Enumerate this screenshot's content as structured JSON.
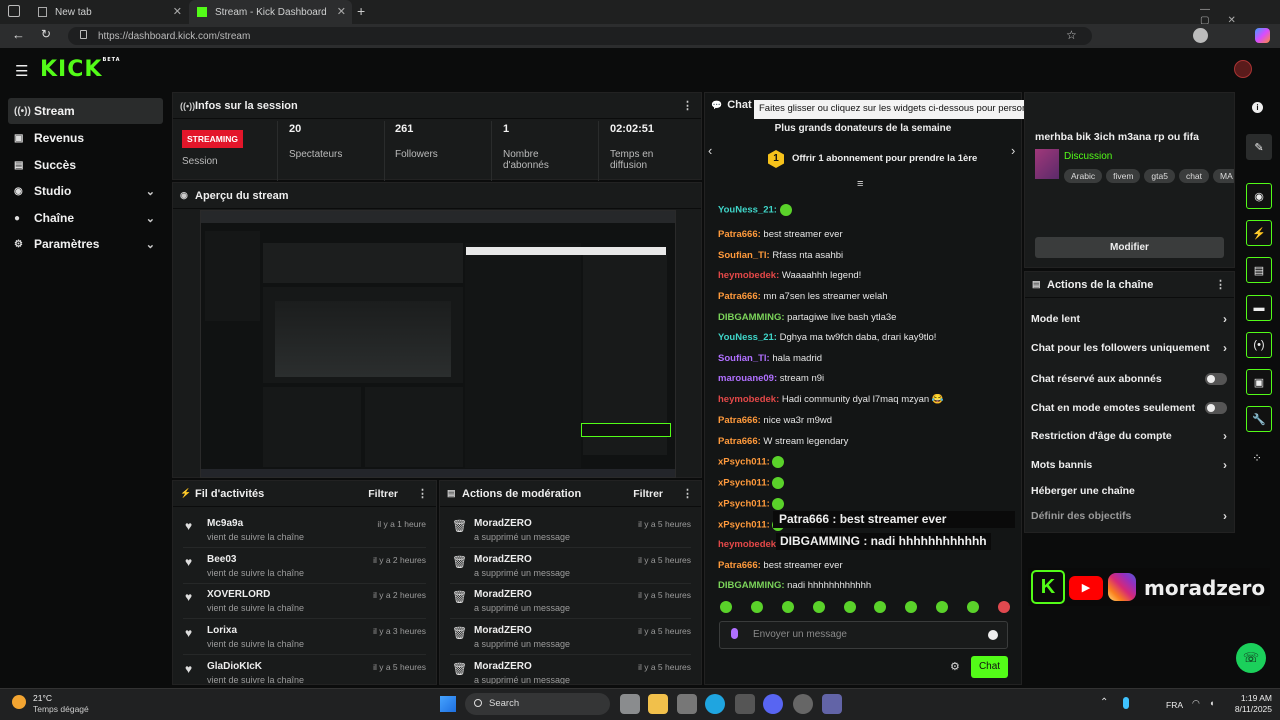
{
  "browser": {
    "tabs": [
      {
        "label": "New tab"
      },
      {
        "label": "Stream - Kick Dashboard"
      }
    ],
    "url": "https://dashboard.kick.com/stream"
  },
  "logo": {
    "text": "KICK",
    "badge": "BETA"
  },
  "sidebar": {
    "items": [
      {
        "label": "Stream"
      },
      {
        "label": "Revenus"
      },
      {
        "label": "Succès"
      },
      {
        "label": "Studio"
      },
      {
        "label": "Chaîne"
      },
      {
        "label": "Paramètres"
      }
    ]
  },
  "session": {
    "title": "Infos sur la session",
    "status": "STREAMING",
    "status_label": "Session",
    "stats": [
      {
        "value": "20",
        "label": "Spectateurs"
      },
      {
        "value": "261",
        "label": "Followers"
      },
      {
        "value": "1",
        "label": "Nombre d'abonnés"
      },
      {
        "value": "02:02:51",
        "label": "Temps en diffusion"
      }
    ]
  },
  "preview": {
    "title": "Aperçu du stream"
  },
  "activity": {
    "title": "Fil d'activités",
    "filter": "Filtrer",
    "rows": [
      {
        "name": "Mc9a9a",
        "sub": "vient de suivre la chaîne",
        "time": "il y a 1 heure"
      },
      {
        "name": "Bee03",
        "sub": "vient de suivre la chaîne",
        "time": "il y a 2 heures"
      },
      {
        "name": "XOVERLORD",
        "sub": "vient de suivre la chaîne",
        "time": "il y a 2 heures"
      },
      {
        "name": "Lorixa",
        "sub": "vient de suivre la chaîne",
        "time": "il y a 3 heures"
      },
      {
        "name": "GlaDioKIcK",
        "sub": "vient de suivre la chaîne",
        "time": "il y a 5 heures"
      }
    ]
  },
  "moderation": {
    "title": "Actions de modération",
    "filter": "Filtrer",
    "rows": [
      {
        "name": "MoradZERO",
        "sub": "a supprimé un message",
        "time": "il y a 5 heures"
      },
      {
        "name": "MoradZERO",
        "sub": "a supprimé un message",
        "time": "il y a 5 heures"
      },
      {
        "name": "MoradZERO",
        "sub": "a supprimé un message",
        "time": "il y a 5 heures"
      },
      {
        "name": "MoradZERO",
        "sub": "a supprimé un message",
        "time": "il y a 5 heures"
      },
      {
        "name": "MoradZERO",
        "sub": "a supprimé un message",
        "time": "il y a 5 heures"
      }
    ]
  },
  "chat": {
    "title": "Chat",
    "tooltip": "Faites glisser ou cliquez sur les widgets ci-dessous pour personnaliser l'affichage de votre tableau de bord",
    "donors_title": "Plus grands donateurs de la semaine",
    "donors_rank": "1",
    "donors_text": "Offrir 1 abonnement pour prendre la 1ère",
    "input_placeholder": "Envoyer un message",
    "send": "Chat",
    "messages": [
      {
        "user": "YouNess_21:",
        "text": "",
        "color": "#3fd5c8",
        "emote": true
      },
      {
        "user": "Patra666:",
        "text": "best streamer ever",
        "color": "#ff9a3c"
      },
      {
        "user": "Soufian_Tl:",
        "text": "Rfass nta asahbi",
        "color": "#ff9a3c"
      },
      {
        "user": "heymobedek:",
        "text": "Waaaahhh legend!",
        "color": "#e34848"
      },
      {
        "user": "Patra666:",
        "text": "mn a7sen les streamer welah",
        "color": "#ff9a3c"
      },
      {
        "user": "DIBGAMMING:",
        "text": "partagiwe live bash ytla3e",
        "color": "#7bd45a"
      },
      {
        "user": "YouNess_21:",
        "text": "Dghya ma tw9fch daba, drari kay9tlo!",
        "color": "#3fd5c8"
      },
      {
        "user": "Soufian_Tl:",
        "text": "hala madrid",
        "color": "#b070ff"
      },
      {
        "user": "marouane09:",
        "text": "stream n9i",
        "color": "#b070ff"
      },
      {
        "user": "heymobedek:",
        "text": "Hadi community dyal l7maq mzyan 😂",
        "color": "#e34848"
      },
      {
        "user": "Patra666:",
        "text": "nice wa3r m9wd",
        "color": "#ff9a3c"
      },
      {
        "user": "Patra666:",
        "text": "W stream legendary",
        "color": "#ff9a3c"
      },
      {
        "user": "xPsych011:",
        "text": "",
        "color": "#ff9a3c",
        "emote": true
      },
      {
        "user": "xPsych011:",
        "text": "",
        "color": "#ff9a3c",
        "emote": true
      },
      {
        "user": "xPsych011:",
        "text": "",
        "color": "#ff9a3c",
        "emote": true
      },
      {
        "user": "xPsych011:",
        "text": "",
        "color": "#ff9a3c",
        "emote": true
      },
      {
        "user": "heymobedek:",
        "text": "",
        "color": "#e34848"
      },
      {
        "user": "Patra666:",
        "text": "best streamer ever",
        "color": "#ff9a3c"
      },
      {
        "user": "DIBGAMMING:",
        "text": "nadi hhhhhhhhhhhh",
        "color": "#7bd45a"
      }
    ],
    "overlay1": "Patra666 : best streamer ever",
    "overlay2": "DIBGAMMING : nadi hhhhhhhhhhhh"
  },
  "stream_info": {
    "title": "merhba bik 3ich m3ana rp ou fifa",
    "category": "Discussion",
    "tags": [
      "Arabic",
      "fivem",
      "gta5",
      "chat",
      "MA"
    ],
    "edit": "Modifier"
  },
  "channel_actions": {
    "title": "Actions de la chaîne",
    "items": [
      {
        "label": "Mode lent",
        "kind": "arrow"
      },
      {
        "label": "Chat pour les followers uniquement",
        "kind": "arrow"
      },
      {
        "label": "Chat réservé aux abonnés",
        "kind": "toggle"
      },
      {
        "label": "Chat en mode emotes seulement",
        "kind": "toggle"
      },
      {
        "label": "Restriction d'âge du compte",
        "kind": "arrow"
      },
      {
        "label": "Mots bannis",
        "kind": "arrow"
      },
      {
        "label": "Héberger une chaîne",
        "kind": "none"
      },
      {
        "label": "Définir des objectifs",
        "kind": "arrow"
      }
    ]
  },
  "overlay_brand": "moradzero",
  "taskbar": {
    "weather_temp": "21°C",
    "weather_text": "Temps dégagé",
    "search": "Search",
    "lang": "FRA",
    "time": "1:19 AM",
    "date": "8/11/2025"
  }
}
